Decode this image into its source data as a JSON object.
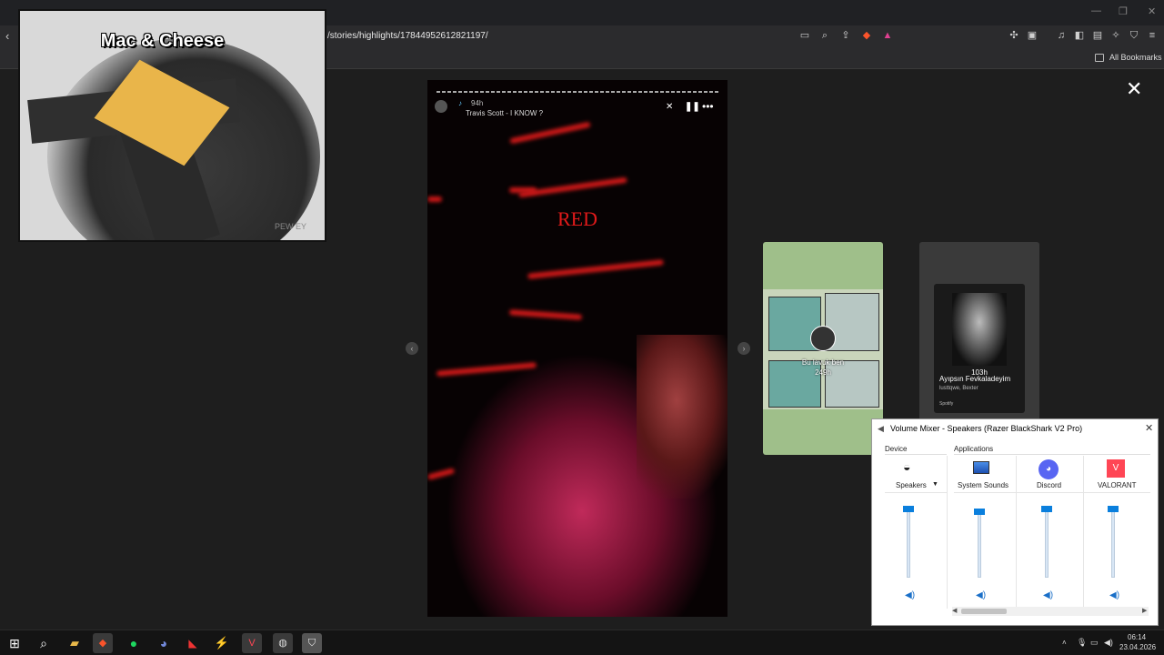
{
  "browser": {
    "url": "/stories/highlights/17844952612821197/",
    "bookmarks_label": "All Bookmarks",
    "window_controls": [
      "—",
      "❐",
      "✕"
    ]
  },
  "pip": {
    "title": "Mac & Cheese",
    "watermark": "PEW  EY"
  },
  "story": {
    "time_ago": "94h",
    "song": "Travis Scott - I KNOW ?",
    "overlay_text": "RED"
  },
  "cards": {
    "card1_label": "Bu lavuk ben",
    "card1_time": "249h",
    "card2_time": "103h",
    "card2_title": "Ayıpsın Fevkaladeyim",
    "card2_artist": "lusttqwe, Bexter",
    "card2_brand": "Spotify"
  },
  "mixer": {
    "title": "Volume Mixer - Speakers (Razer BlackShark V2 Pro)",
    "device_header": "Device",
    "apps_header": "Applications",
    "channels": [
      {
        "label": "Speakers",
        "icon": "headset-icon",
        "level": 1.0
      },
      {
        "label": "System Sounds",
        "icon": "system-sounds-icon",
        "level": 0.96
      },
      {
        "label": "Discord",
        "icon": "discord-icon",
        "level": 1.0
      },
      {
        "label": "VALORANT",
        "icon": "valorant-icon",
        "level": 1.0
      }
    ]
  },
  "taskbar": {
    "time": "06:14",
    "date": "23.04.2026"
  },
  "colors": {
    "accent": "#0a7fdd",
    "story_red": "#e01a1a",
    "discord": "#5865f2",
    "valorant": "#ff4655"
  }
}
